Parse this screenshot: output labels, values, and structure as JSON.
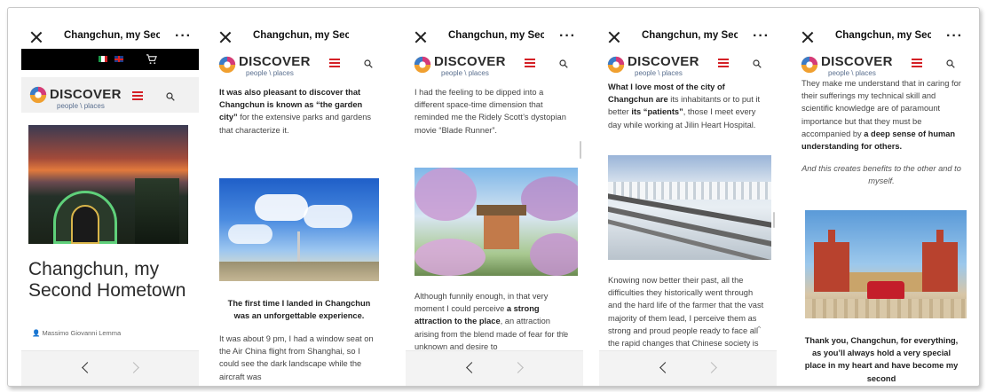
{
  "app": {
    "title": "Changchun, my Seco"
  },
  "brand": {
    "name": "DISCOVER",
    "tagline": "people \\ places"
  },
  "screens": [
    {
      "id": "s1",
      "article_title": "Changchun, my Second Hometown",
      "author": "Massimo Giovanni Lemma"
    },
    {
      "id": "s2",
      "para1_bold_a": "It was also pleasant to discover that Changchun is known as “the garden city”",
      "para1_rest": " for the extensive parks and gardens that characterize it.",
      "para2_bold": "The first time I landed in Changchun was an unforgettable experience.",
      "para3": "It was about 9 pm, I had a window seat on the Air China flight from Shanghai, so I could see the dark landscape while the aircraft was"
    },
    {
      "id": "s3",
      "para1": "I had the feeling to be dipped into a different space-time dimension that reminded me the Ridely Scott’s dystopian movie “Blade Runner”.",
      "para2_a": "Although funnily enough, in that very moment I could perceive ",
      "para2_bold_a": "a strong attraction",
      "para2_b": "  to the ",
      "para2_bold_b": "place",
      "para2_c": ", an attraction arising from the blend made of fear for the unknown and desire to"
    },
    {
      "id": "s4",
      "para1_bold_a": "What I love most of the city of Changchun are",
      "para1_mid": " its inhabitants or to put it better ",
      "para1_bold_b": "its “patients”",
      "para1_rest": ", those I meet every day while working at Jilin Heart Hospital.",
      "para2": "Knowing now better their past, all the difficulties they historically went through and the hard life of the farmer that the vast majority of them lead, I perceive them as strong and proud people ready to face all the rapid changes that Chinese society is going"
    },
    {
      "id": "s5",
      "para1_a": "They make me understand that in caring for their sufferings my technical skill and scientific knowledge are of paramount importance but that they must be accompanied by ",
      "para1_bold": "a deep sense of human understanding for others.",
      "para2": "And this creates benefits to the other and to myself.",
      "para3_bold": "Thank you, Changchun, for everything, as you’ll always hold a very special place in my heart and have become my second"
    }
  ],
  "colors": {
    "accent_red": "#d42026",
    "logo_blue": "#5a6f8f"
  }
}
